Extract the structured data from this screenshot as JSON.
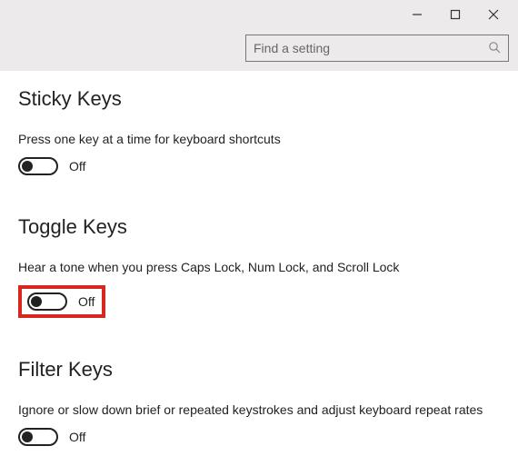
{
  "search": {
    "placeholder": "Find a setting"
  },
  "sections": {
    "sticky": {
      "title": "Sticky Keys",
      "desc": "Press one key at a time for keyboard shortcuts",
      "state": "Off"
    },
    "toggle": {
      "title": "Toggle Keys",
      "desc": "Hear a tone when you press Caps Lock, Num Lock, and Scroll Lock",
      "state": "Off"
    },
    "filter": {
      "title": "Filter Keys",
      "desc": "Ignore or slow down brief or repeated keystrokes and adjust keyboard repeat rates",
      "state": "Off"
    }
  }
}
